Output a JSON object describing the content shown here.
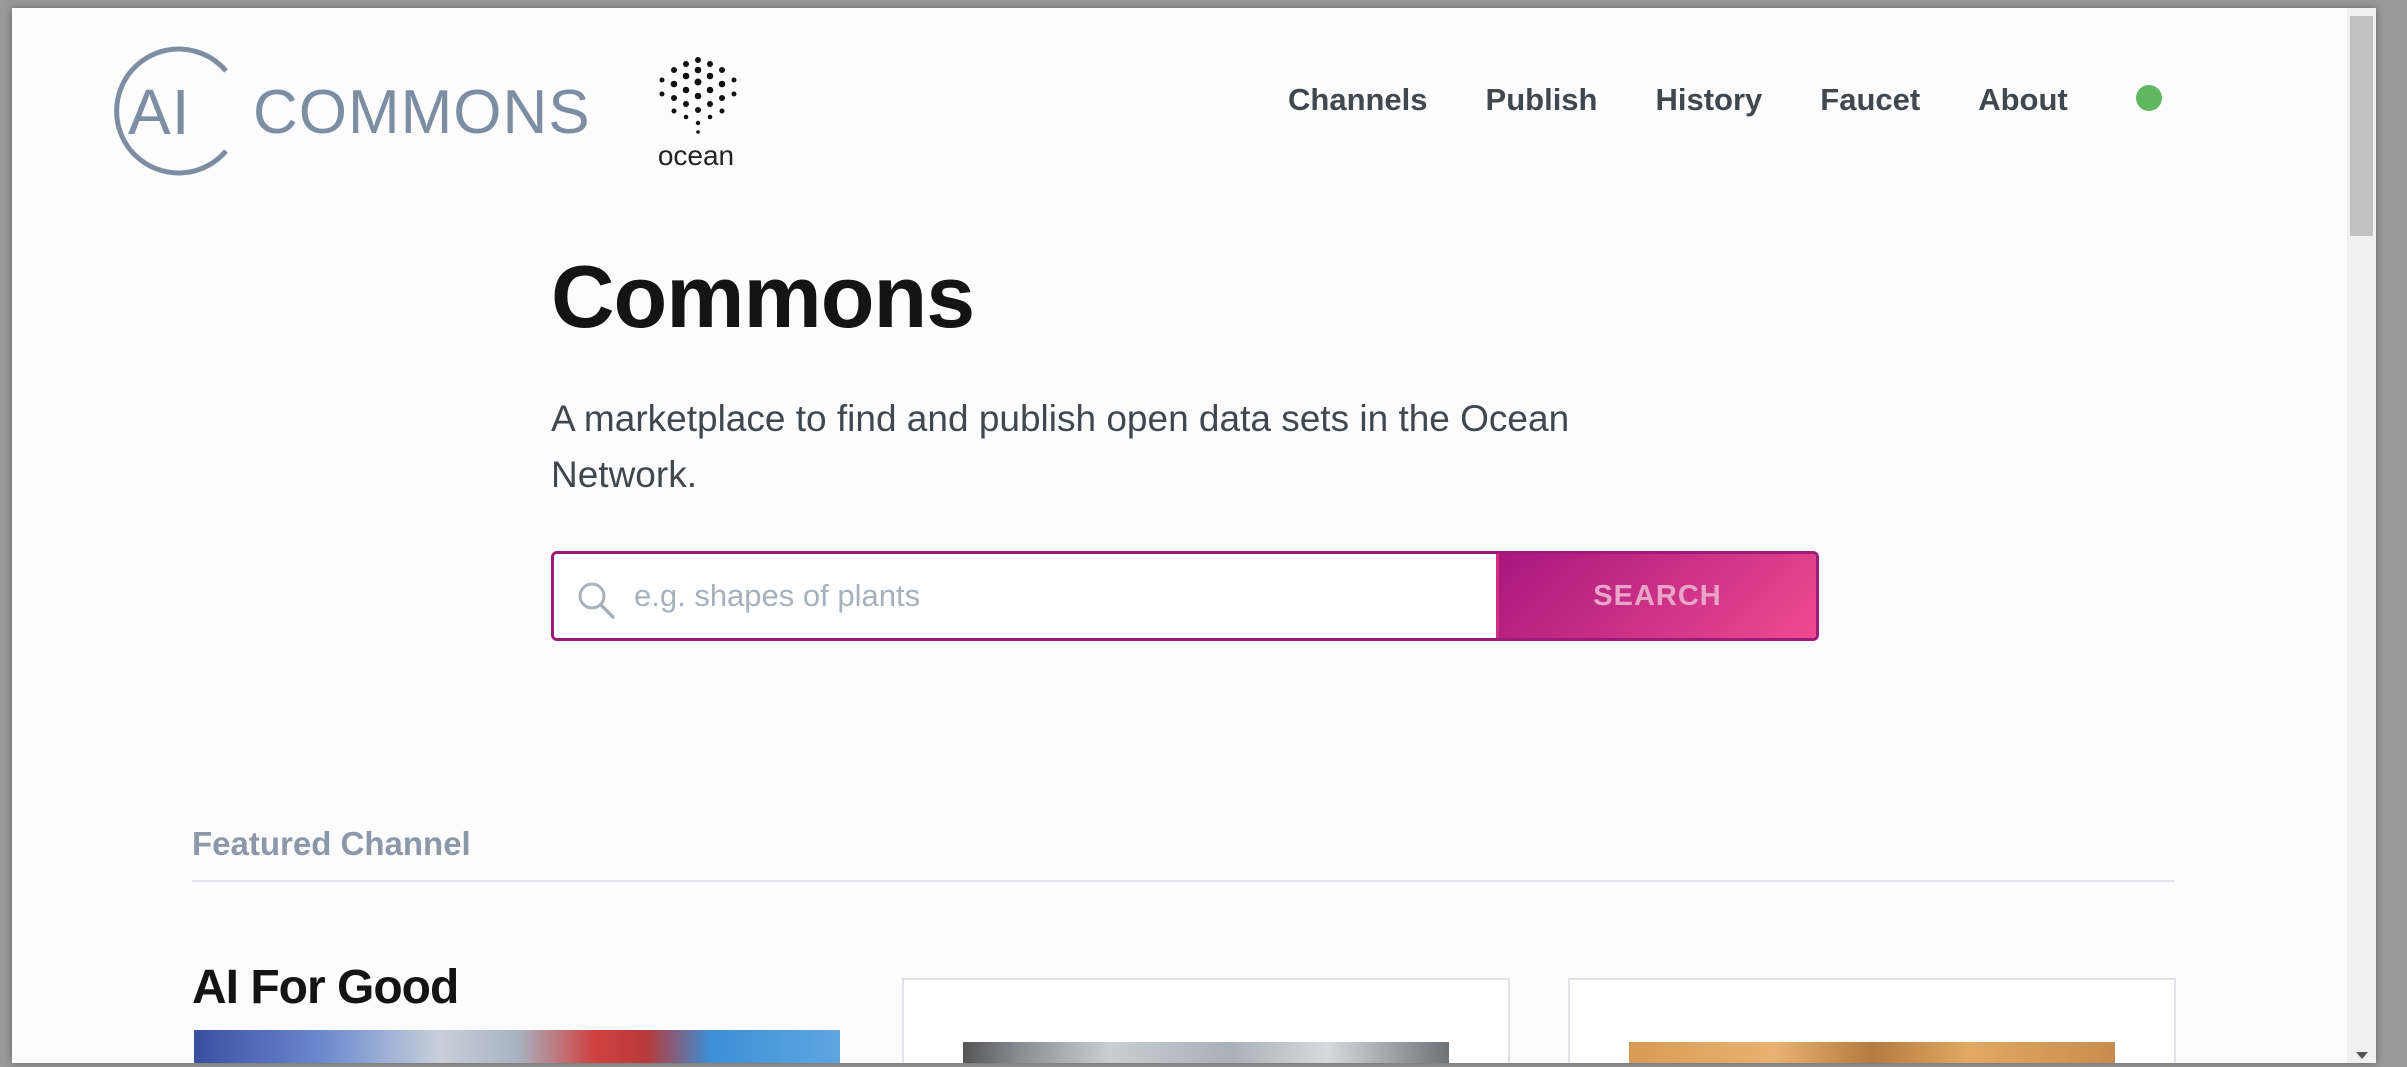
{
  "header": {
    "logo_ai": "AI",
    "logo_commons": "COMMONS",
    "ocean_logo_text": "ocean",
    "nav": [
      "Channels",
      "Publish",
      "History",
      "Faucet",
      "About"
    ],
    "status_color": "#5fb85f"
  },
  "hero": {
    "title": "Commons",
    "description": "A marketplace to find and publish open data sets in the Ocean Network.",
    "search_placeholder": "e.g. shapes of plants",
    "search_button": "SEARCH"
  },
  "featured": {
    "label": "Featured Channel",
    "channel_title": "AI For Good"
  },
  "colors": {
    "accent": "#d42c83",
    "accent_dark": "#9d1b7a",
    "logo_gray": "#7d8ea2"
  }
}
